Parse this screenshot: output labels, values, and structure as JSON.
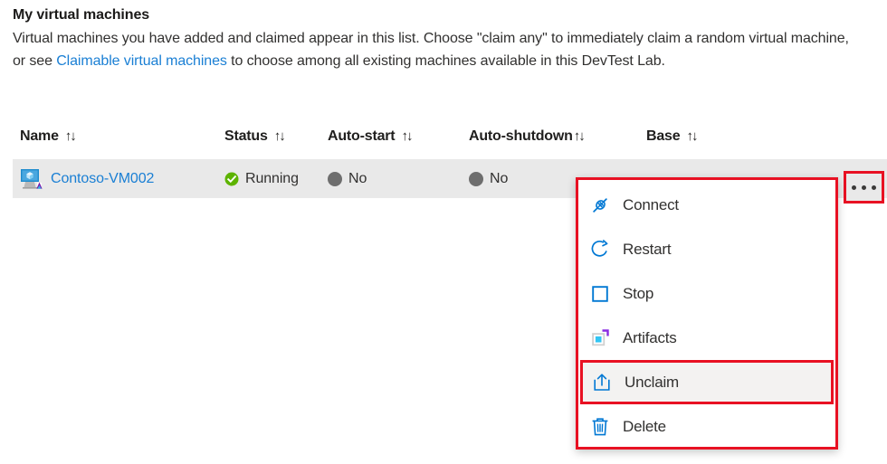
{
  "intro": {
    "title": "My virtual machines",
    "body_before_link": "Virtual machines you have added and claimed appear in this list. Choose \"claim any\" to immediately claim a random virtual machine, or see ",
    "link_text": "Claimable virtual machines",
    "body_after_link": " to choose among all existing machines available in this DevTest Lab."
  },
  "table": {
    "sort_glyph": "↑↓",
    "columns": [
      {
        "key": "name",
        "label": "Name"
      },
      {
        "key": "status",
        "label": "Status"
      },
      {
        "key": "autostart",
        "label": "Auto-start"
      },
      {
        "key": "autoshutdown",
        "label": "Auto-shutdown"
      },
      {
        "key": "base",
        "label": "Base"
      }
    ],
    "rows": [
      {
        "name": "Contoso-VM002",
        "name_icon": "virtual-machine-icon",
        "status": "Running",
        "status_icon": "status-running-check-icon",
        "autostart": "No",
        "autostart_icon": "status-disabled-dot-icon",
        "autoshutdown": "No",
        "autoshutdown_icon": "status-disabled-dot-icon",
        "base": ""
      }
    ]
  },
  "row_actions": {
    "ellipsis_label": "•••",
    "ellipsis_name": "more-actions-button"
  },
  "context_menu": {
    "items": [
      {
        "label": "Connect",
        "icon": "plug-connect-icon",
        "selected": false
      },
      {
        "label": "Restart",
        "icon": "restart-arrow-icon",
        "selected": false
      },
      {
        "label": "Stop",
        "icon": "stop-square-icon",
        "selected": false
      },
      {
        "label": "Artifacts",
        "icon": "artifacts-icon",
        "selected": false
      },
      {
        "label": "Unclaim",
        "icon": "unclaim-upload-icon",
        "selected": true
      },
      {
        "label": "Delete",
        "icon": "trash-delete-icon",
        "selected": false
      }
    ]
  },
  "colors": {
    "link": "#1a7fd4",
    "highlight_red": "#e81123",
    "row_background": "#e9e9e9",
    "selected_item_background": "#f3f2f1",
    "status_running_green": "#5db300",
    "status_disabled_gray": "#6e6e6e",
    "icon_blue": "#0078d4",
    "text": "#323130"
  }
}
